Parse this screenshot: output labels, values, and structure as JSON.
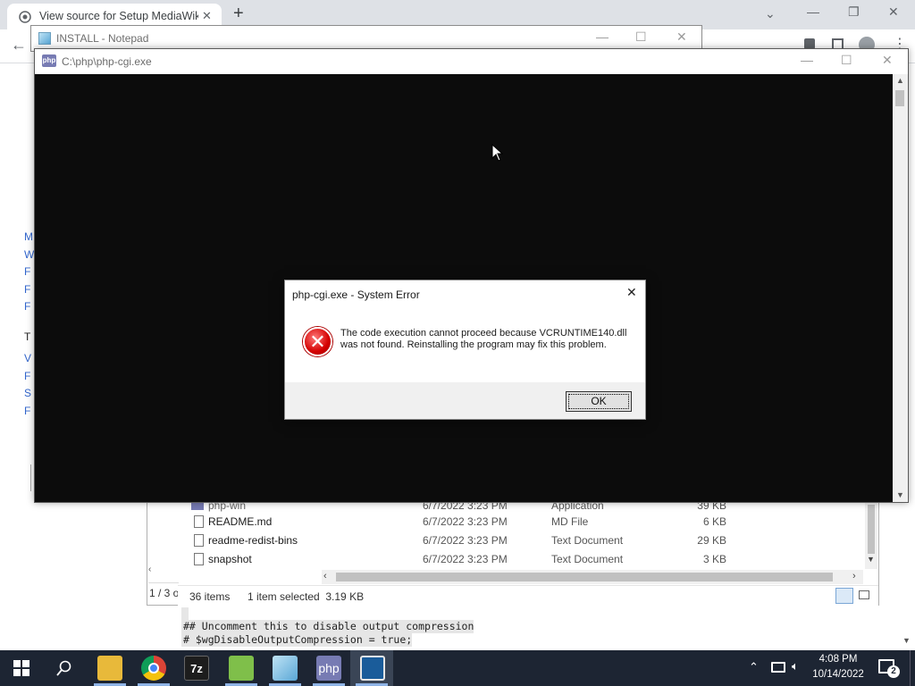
{
  "browser": {
    "tab_title": "View source for Setup MediaWik",
    "new_tab_symbol": "+",
    "back_symbol": "←"
  },
  "left_links": [
    "M",
    "W",
    "F",
    "F",
    "F",
    "T",
    "V",
    "F",
    "S",
    "F"
  ],
  "notepad": {
    "title": "INSTALL - Notepad"
  },
  "cmd": {
    "title": "C:\\php\\php-cgi.exe",
    "icon_label": "php"
  },
  "dialog": {
    "title": "php-cgi.exe - System Error",
    "message": "The code execution cannot proceed because VCRUNTIME140.dll was not found. Reinstalling the program may fix this problem.",
    "ok_label": "OK",
    "close_symbol": "✕"
  },
  "explorer": {
    "rows": [
      {
        "name": "php-win",
        "date": "6/7/2022 3:23 PM",
        "type": "Application",
        "size": "39 KB"
      },
      {
        "name": "README.md",
        "date": "6/7/2022 3:23 PM",
        "type": "MD File",
        "size": "6 KB"
      },
      {
        "name": "readme-redist-bins",
        "date": "6/7/2022 3:23 PM",
        "type": "Text Document",
        "size": "29 KB"
      },
      {
        "name": "snapshot",
        "date": "6/7/2022 3:23 PM",
        "type": "Text Document",
        "size": "3 KB"
      }
    ],
    "status_items": "36 items",
    "status_selected": "1 item selected  3.19 KB",
    "page_indicator": "1 / 3 o"
  },
  "editor": {
    "lines": [
      "## Uncomment this to disable output compression",
      "# $wgDisableOutputCompression = true;"
    ]
  },
  "taskbar": {
    "apps": [
      "file-explorer",
      "chrome",
      "7zip",
      "notepad-plus",
      "notepad",
      "php",
      "active-window"
    ],
    "seven_zip_label": "7z",
    "php_label": "php",
    "time": "4:08 PM",
    "date": "10/14/2022",
    "notification_count": "2"
  }
}
